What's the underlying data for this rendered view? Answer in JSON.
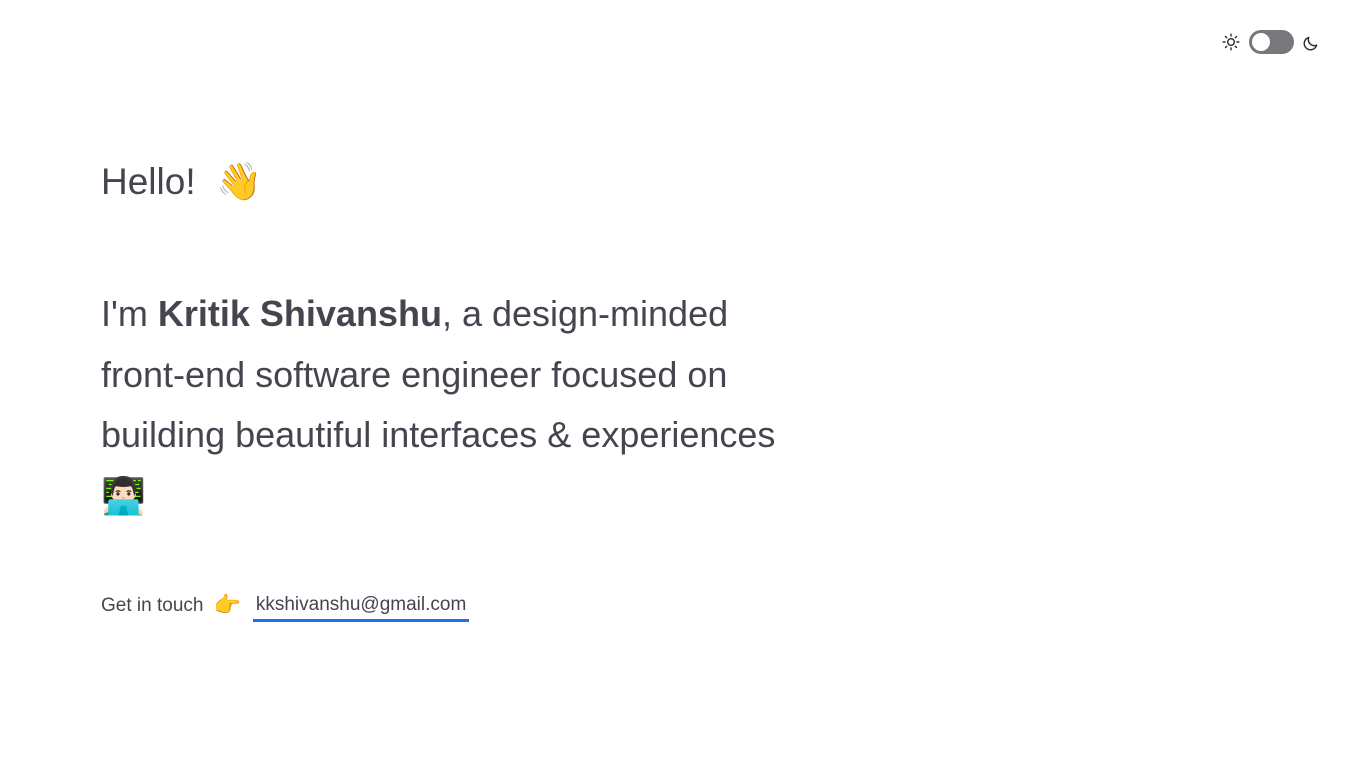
{
  "theme_switcher": {
    "light_icon": "sun-icon",
    "dark_icon": "moon-icon",
    "toggle_state": "light"
  },
  "hero": {
    "greeting": "Hello!",
    "greeting_emoji": "👋",
    "intro_prefix": "I'm ",
    "name": "Kritik Shivanshu",
    "intro_suffix": ", a design-minded front-end software engineer focused on building beautiful interfaces & experiences",
    "intro_emoji": "👨🏻‍💻"
  },
  "contact": {
    "label": "Get in touch",
    "pointer_emoji": "👉",
    "email": "kkshivanshu@gmail.com"
  },
  "colors": {
    "text": "#45454f",
    "link_underline": "#1a73e8",
    "toggle_track": "#77777c",
    "background": "#ffffff"
  }
}
